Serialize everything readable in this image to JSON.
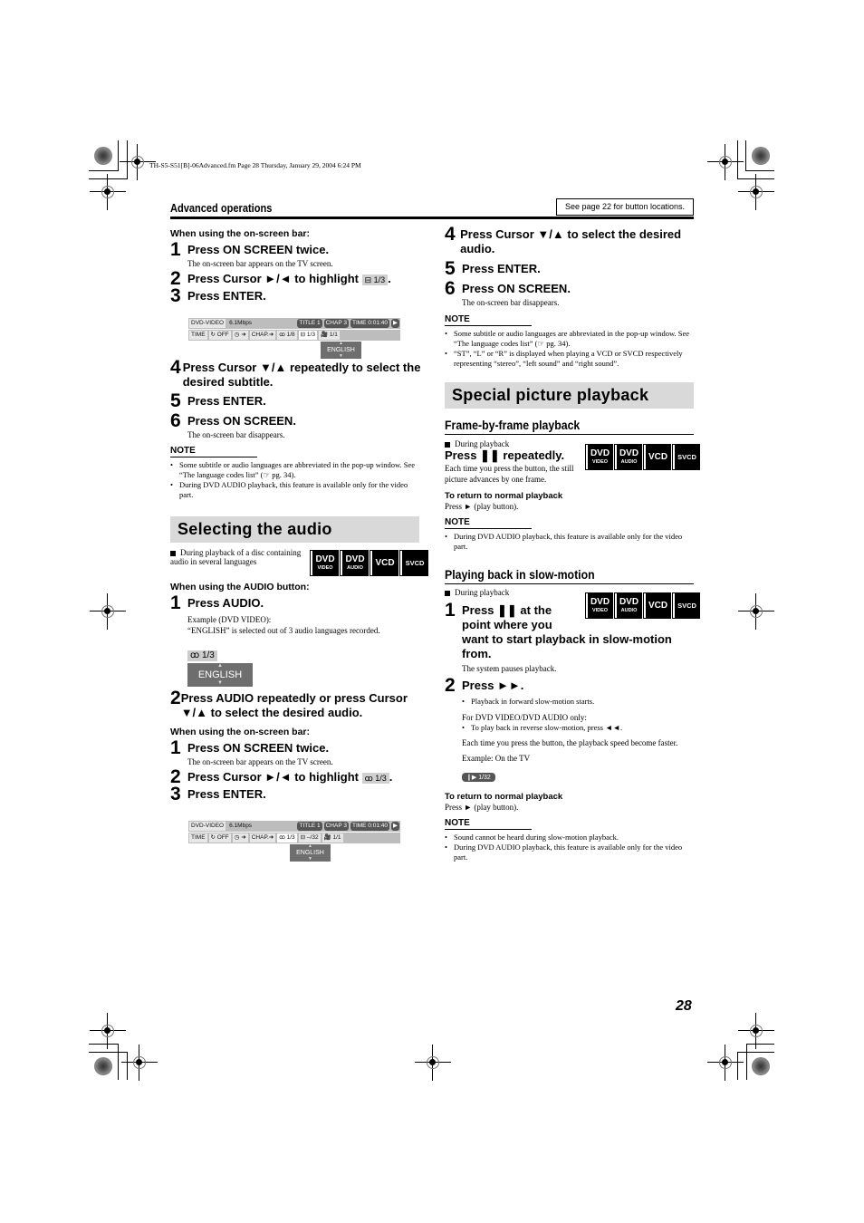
{
  "file_header": "TH-S5-S51[B]-06Advanced.fm  Page 28  Thursday, January 29, 2004  6:24 PM",
  "section_label": "Advanced operations",
  "see_page": "See page 22 for button locations.",
  "page_number": "28",
  "left": {
    "subtitle_block": {
      "when": "When using the on-screen bar:",
      "steps": [
        {
          "num": "1",
          "text": "Press ON SCREEN twice.",
          "desc": "The on-screen bar appears on the TV screen."
        },
        {
          "num": "2",
          "text_before": "Press Cursor ►/◄ to highlight",
          "icon_label": "⊟ 1/3",
          "text_after": "."
        },
        {
          "num": "3",
          "text": "Press ENTER."
        },
        {
          "num": "4",
          "text": "Press Cursor ▼/▲ repeatedly to select the desired subtitle."
        },
        {
          "num": "5",
          "text": "Press ENTER."
        },
        {
          "num": "6",
          "text": "Press ON SCREEN.",
          "desc": "The on-screen bar disappears."
        }
      ],
      "osb": {
        "row1": [
          "DVD-VIDEO",
          "6.1Mbps",
          "TITLE  1",
          "CHAP  3",
          "TIME  0:01:40",
          "▶"
        ],
        "row2": [
          "TIME",
          "↻ OFF",
          "◷ ➜",
          "CHAP.➜",
          "ꝏ 1/8",
          "⊟ 1/3",
          "🎥 1/1"
        ],
        "popup": "ENGLISH"
      },
      "note_title": "NOTE",
      "notes": [
        "Some subtitle or audio languages are abbreviated in the pop-up window. See “The language codes list” (☞ pg. 34).",
        "During DVD AUDIO playback, this feature is available only for the video part."
      ]
    },
    "audio_section": {
      "title": "Selecting the audio",
      "condition": "During playback of a disc containing audio in several languages",
      "badges": [
        {
          "top": "DVD",
          "bottom": "VIDEO"
        },
        {
          "top": "DVD",
          "bottom": "AUDIO"
        },
        {
          "top": "VCD"
        },
        {
          "top": "SVCD"
        }
      ],
      "when_audio": "When using the AUDIO button:",
      "audio_steps": [
        {
          "num": "1",
          "text": "Press AUDIO.",
          "desc1": "Example (DVD VIDEO):",
          "desc2": "“ENGLISH” is selected out of 3 audio languages recorded."
        },
        {
          "num": "2",
          "text": "Press AUDIO repeatedly or press Cursor ▼/▲ to select the desired audio."
        }
      ],
      "example_display": {
        "label": "ꝏ 1/3",
        "value": "ENGLISH"
      },
      "when_osb": "When using the on-screen bar:",
      "osb_steps": [
        {
          "num": "1",
          "text": "Press ON SCREEN twice.",
          "desc": "The on-screen bar appears on the TV screen."
        },
        {
          "num": "2",
          "text_before": "Press Cursor ►/◄ to highlight",
          "icon_label": "ꝏ 1/3",
          "text_after": "."
        },
        {
          "num": "3",
          "text": "Press ENTER."
        }
      ],
      "osb": {
        "row1": [
          "DVD-VIDEO",
          "6.1Mbps",
          "TITLE  1",
          "CHAP  3",
          "TIME  0:01:40",
          "▶"
        ],
        "row2": [
          "TIME",
          "↻ OFF",
          "◷ ➜",
          "CHAP.➜",
          "ꝏ 1/3",
          "⊟ –/32",
          "🎥 1/1"
        ],
        "popup": "ENGLISH"
      }
    }
  },
  "right": {
    "audio_steps_cont": [
      {
        "num": "4",
        "text": "Press Cursor ▼/▲ to select the desired audio."
      },
      {
        "num": "5",
        "text": "Press ENTER."
      },
      {
        "num": "6",
        "text": "Press ON SCREEN.",
        "desc": "The on-screen bar disappears."
      }
    ],
    "note_title": "NOTE",
    "notes": [
      "Some subtitle or audio languages are abbreviated in the pop-up window. See “The language codes list” (☞ pg. 34).",
      "“ST”, “L” or “R” is displayed when playing a VCD or SVCD respectively representing “stereo”, “left sound” and “right sound”."
    ],
    "special_section": {
      "title": "Special picture playback",
      "frame": {
        "title": "Frame-by-frame playback",
        "condition": "During playback",
        "action": "Press ❚❚ repeatedly.",
        "desc": "Each time you press the button, the still picture advances by one frame.",
        "return_title": "To return to normal playback",
        "return_text": "Press ► (play button).",
        "note_title": "NOTE",
        "notes": [
          "During DVD AUDIO playback, this feature is available only for the video part."
        ]
      },
      "slow": {
        "title": "Playing back in slow-motion",
        "condition": "During playback",
        "step1": {
          "num": "1",
          "text": "Press ❚❚ at the point where you want to start playback in slow-motion from.",
          "desc": "The system pauses playback."
        },
        "step2": {
          "num": "2",
          "text": "Press ►►.",
          "bullet": "Playback in forward slow-motion starts."
        },
        "dvd_only": "For DVD VIDEO/DVD AUDIO only:",
        "reverse": "To play back in reverse slow-motion, press ◄◄.",
        "speed": "Each time you press the button, the playback speed become faster.",
        "example": "Example: On the TV",
        "tv_display": "❙▶ 1/32",
        "return_title": "To return to normal playback",
        "return_text": "Press ► (play button).",
        "note_title": "NOTE",
        "notes": [
          "Sound cannot be heard during slow-motion playback.",
          "During DVD AUDIO playback, this feature is available only for the video part."
        ]
      }
    }
  }
}
